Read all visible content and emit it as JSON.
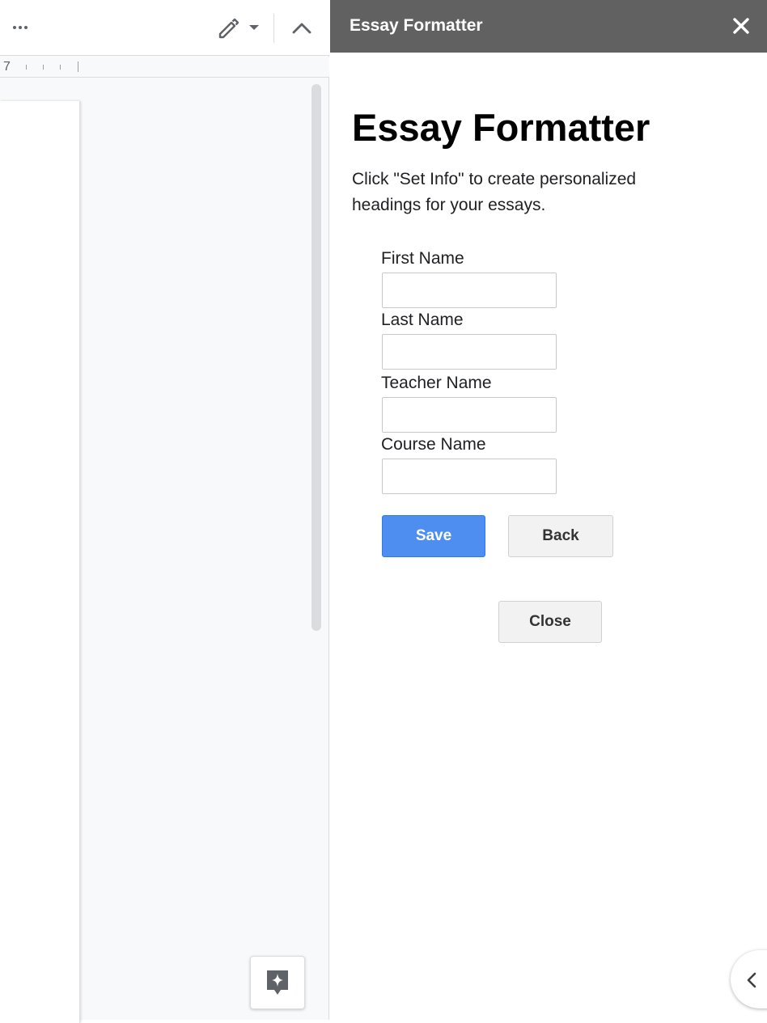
{
  "toolbar": {
    "more_icon": "more-horiz-icon",
    "edit_icon": "pencil-icon",
    "edit_menu_icon": "caret-down-icon",
    "collapse_icon": "chevron-up-icon"
  },
  "ruler": {
    "number": "7"
  },
  "sidebar": {
    "header_title": "Essay Formatter",
    "close_icon": "close-icon",
    "heading": "Essay Formatter",
    "description": "Click \"Set Info\" to create personalized headings for your essays."
  },
  "form": {
    "fields": [
      {
        "label": "First Name",
        "value": ""
      },
      {
        "label": "Last Name",
        "value": ""
      },
      {
        "label": "Teacher Name",
        "value": ""
      },
      {
        "label": "Course Name",
        "value": ""
      }
    ],
    "save_label": "Save",
    "back_label": "Back",
    "close_label": "Close"
  },
  "colors": {
    "header_bg": "#616161",
    "save_button": "#4d8ef0"
  },
  "floating": {
    "explore_icon": "explore-sparkle-icon",
    "expand_icon": "chevron-left-icon"
  }
}
